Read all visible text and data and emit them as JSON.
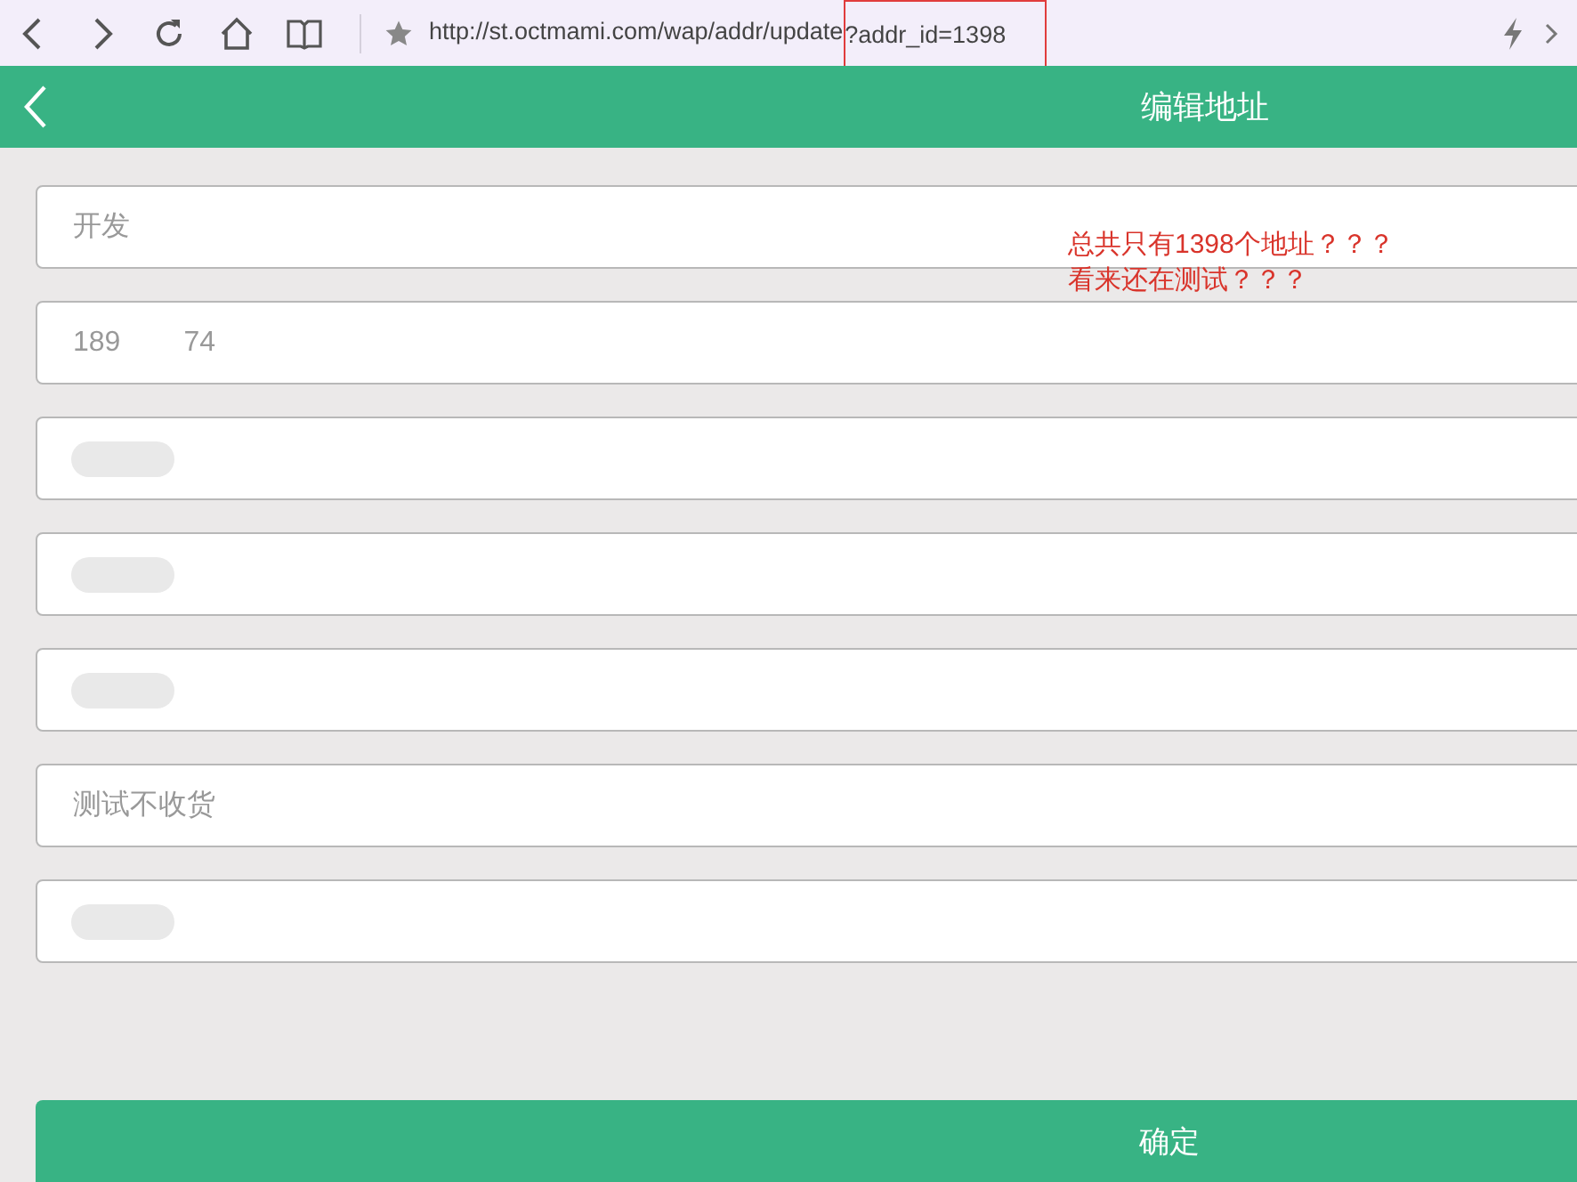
{
  "browser": {
    "url_parts": [
      {
        "text": "http://st.octmami.com/wap/addr/update",
        "highlighted": false
      },
      {
        "text": "?addr_id=1398",
        "highlighted": true
      }
    ]
  },
  "header": {
    "title": "编辑地址"
  },
  "fields": [
    {
      "kind": "text",
      "value": "开发"
    },
    {
      "kind": "text",
      "value": "189        74"
    },
    {
      "kind": "blurred"
    },
    {
      "kind": "blurred"
    },
    {
      "kind": "blurred"
    },
    {
      "kind": "text",
      "value": "测试不收货"
    },
    {
      "kind": "blurred"
    }
  ],
  "annotation": {
    "lines": [
      "总共只有1398个地址？？？",
      "看来还在测试？？？"
    ]
  },
  "submit_button": {
    "label": "确定"
  }
}
